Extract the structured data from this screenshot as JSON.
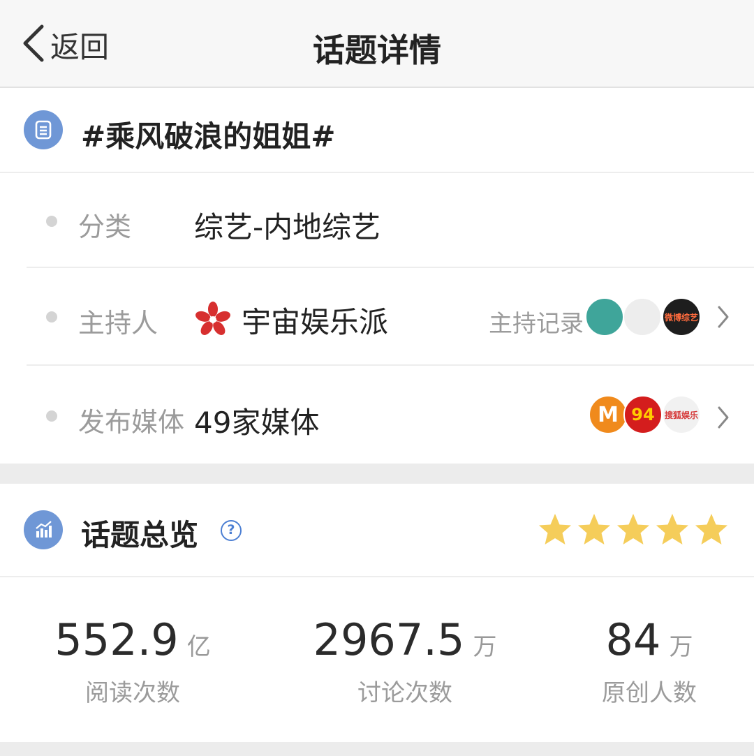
{
  "nav": {
    "back_label": "返回",
    "title": "话题详情"
  },
  "topic": {
    "icon": "list-icon",
    "title": "#乘风破浪的姐姐#",
    "rows": [
      {
        "label": "分类",
        "value": "综艺-内地综艺"
      },
      {
        "label": "主持人",
        "value": "宇宙娱乐派",
        "record_label": "主持记录",
        "host_icon": "flower-logo-icon"
      },
      {
        "label": "发布媒体",
        "value": "49家媒体"
      }
    ],
    "host_avatar_texts": [
      "",
      "",
      "微博综艺"
    ],
    "media_avatar_texts": [
      "M",
      "94",
      "搜狐娱乐"
    ]
  },
  "overview": {
    "icon": "bar-chart-icon",
    "title": "话题总览",
    "help_icon": "question-icon",
    "rating_stars": 5,
    "accent_star_color": "#f5cd5a",
    "stats": [
      {
        "value": "552.9",
        "unit": "亿",
        "label": "阅读次数"
      },
      {
        "value": "2967.5",
        "unit": "万",
        "label": "讨论次数"
      },
      {
        "value": "84",
        "unit": "万",
        "label": "原创人数"
      }
    ]
  }
}
